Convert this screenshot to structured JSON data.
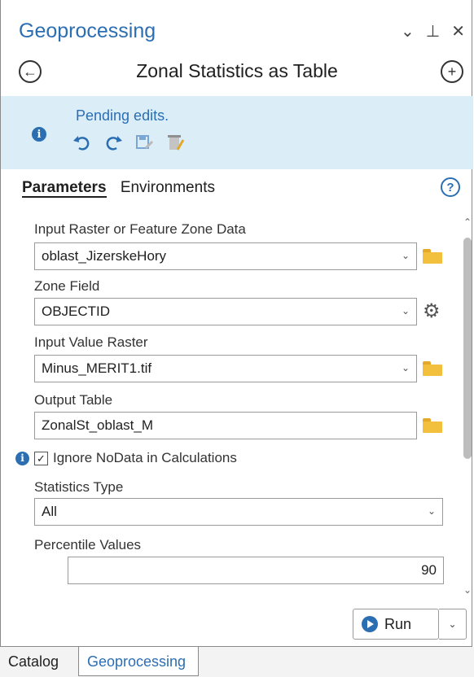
{
  "window": {
    "title": "Geoprocessing",
    "controls": {
      "dropdown": "⌄",
      "pin": "⊥",
      "close": "✕"
    }
  },
  "nav": {
    "back_icon": "arrow-left-circle-icon",
    "tool_name": "Zonal Statistics as Table",
    "add_icon": "plus-circle-icon"
  },
  "edits_banner": {
    "message": "Pending edits.",
    "info_glyph": "i",
    "tools": [
      "undo-icon",
      "redo-icon",
      "save-edits-icon",
      "discard-edits-icon"
    ]
  },
  "tabs": {
    "parameters": "Parameters",
    "environments": "Environments",
    "help": "?"
  },
  "parameters": {
    "input_zone": {
      "label": "Input Raster or Feature Zone Data",
      "value": "oblast_JizerskeHory"
    },
    "zone_field": {
      "label": "Zone Field",
      "value": "OBJECTID"
    },
    "value_raster": {
      "label": "Input Value Raster",
      "value": "Minus_MERIT1.tif"
    },
    "output_table": {
      "label": "Output Table",
      "value": "ZonalSt_oblast_M"
    },
    "ignore_nodata": {
      "label": "Ignore NoData in Calculations",
      "checked": true,
      "info_glyph": "i"
    },
    "statistics_type": {
      "label": "Statistics Type",
      "value": "All"
    },
    "percentile": {
      "label": "Percentile Values",
      "value": "90"
    }
  },
  "run": {
    "label": "Run"
  },
  "bottom_tabs": [
    "Catalog",
    "Geoprocessing"
  ],
  "colors": {
    "accent": "#2c6eb2",
    "banner": "#dbeef8",
    "folder": "#f2c03c"
  }
}
